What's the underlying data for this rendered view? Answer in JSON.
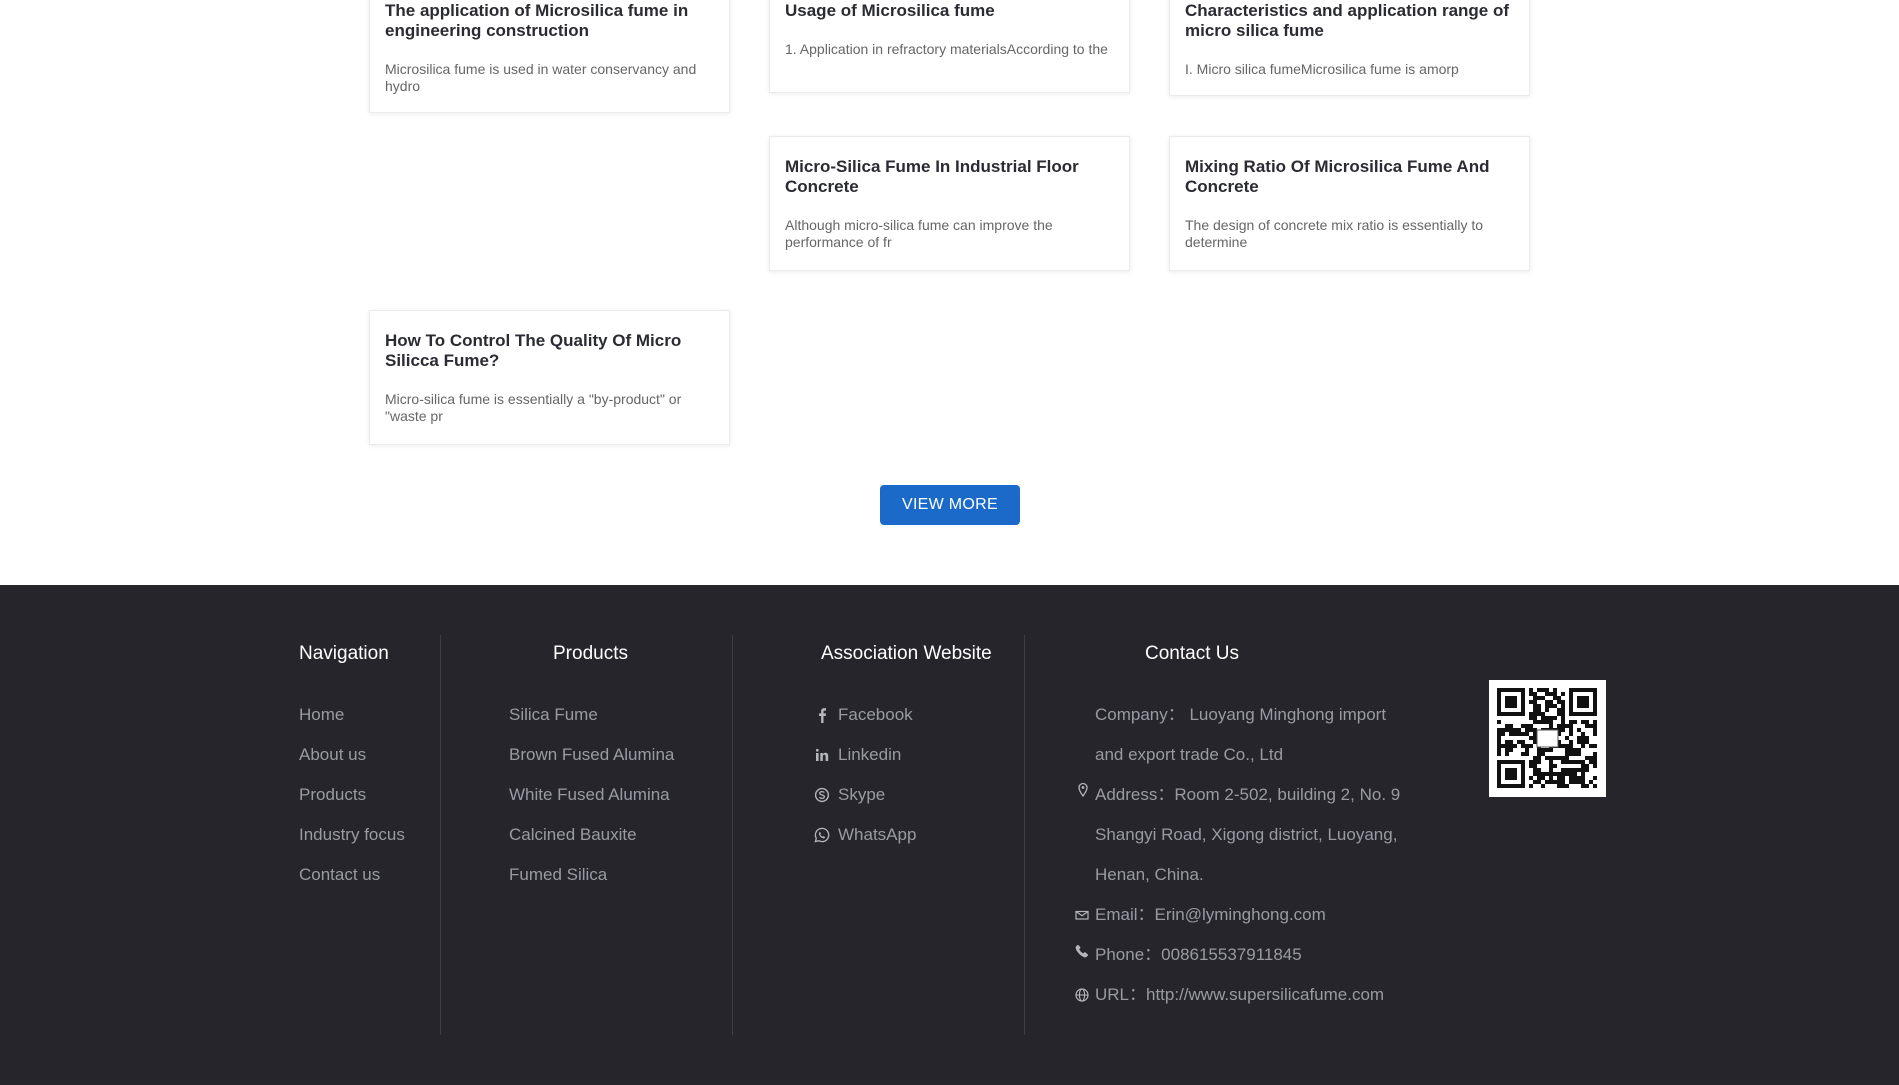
{
  "articles": [
    {
      "title": "The application of Microsilica fume in engineering construction",
      "desc": "Microsilica fume is used in water conservancy and hydro"
    },
    {
      "title": "Usage of Microsilica fume",
      "desc": "1. Application in refractory materialsAccording to the"
    },
    {
      "title": "Characteristics and application range of micro silica fume",
      "desc": "I. Micro silica fumeMicrosilica fume is amorp"
    },
    {
      "title": "Micro-Silica Fume In Industrial Floor Concrete",
      "desc": "Although micro-silica fume can improve the performance of fr"
    },
    {
      "title": "Mixing Ratio Of Microsilica Fume And Concrete",
      "desc": "The design of concrete mix ratio is essentially to determine"
    },
    {
      "title": "How To Control The Quality Of Micro Silicca Fume?",
      "desc": "Micro-silica fume is essentially a \"by-product\" or \"waste pr"
    }
  ],
  "view_more": "VIEW MORE",
  "footer": {
    "navigation": {
      "title": "Navigation",
      "items": [
        "Home",
        "About us",
        "Products",
        "Industry focus",
        "Contact us"
      ]
    },
    "products": {
      "title": "Products",
      "items": [
        "Silica Fume",
        "Brown Fused Alumina",
        "White Fused Alumina",
        "Calcined Bauxite",
        "Fumed Silica"
      ]
    },
    "association": {
      "title": "Association Website",
      "items": [
        {
          "label": "Facebook",
          "icon": "facebook-icon"
        },
        {
          "label": "Linkedin",
          "icon": "linkedin-icon"
        },
        {
          "label": "Skype",
          "icon": "skype-icon"
        },
        {
          "label": "WhatsApp",
          "icon": "whatsapp-icon"
        }
      ]
    },
    "contact": {
      "title": "Contact Us",
      "company_line1": "Company：  Luoyang Minghong import",
      "company_line2": "and export trade Co., Ltd",
      "address_line1": "Address：Room 2-502, building 2, No. 9",
      "address_line2": "Shangyi Road, Xigong district, Luoyang,",
      "address_line3": "Henan, China.",
      "email": "Email：Erin@lyminghong.com",
      "phone": "Phone：008615537911845",
      "url": "URL：http://www.supersilicafume.com"
    }
  },
  "colors": {
    "accent": "#1b6ac9",
    "footer_bg": "#25252b",
    "footer_text": "#9a9aa2"
  }
}
